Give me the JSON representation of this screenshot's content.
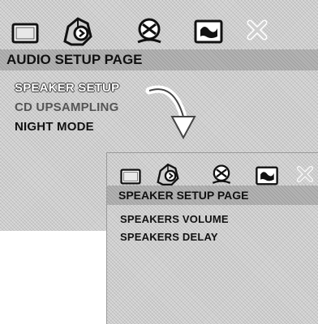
{
  "main_page": {
    "title": "AUDIO SETUP PAGE",
    "items": [
      {
        "label": "SPEAKER SETUP",
        "state": "highlighted"
      },
      {
        "label": "CD UPSAMPLING",
        "state": "dimmed"
      },
      {
        "label": "NIGHT MODE",
        "state": "normal"
      }
    ],
    "tab_icons": [
      "general-setup-icon",
      "audio-setup-icon",
      "video-setup-icon",
      "preference-setup-icon",
      "exit-icon"
    ]
  },
  "sub_page": {
    "title": "SPEAKER SETUP PAGE",
    "items": [
      {
        "label": "SPEAKERS VOLUME"
      },
      {
        "label": "SPEAKERS DELAY"
      }
    ]
  }
}
